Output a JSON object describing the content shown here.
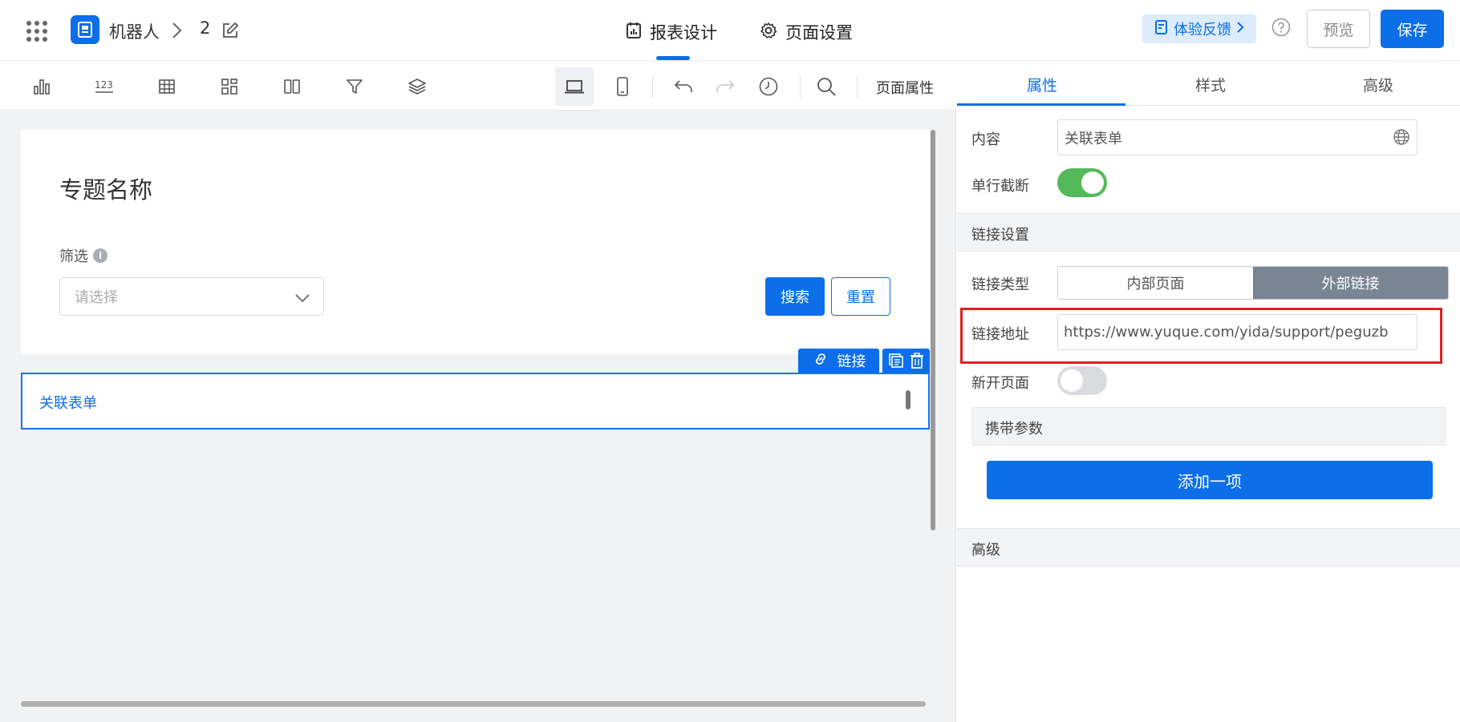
{
  "header": {
    "app_name": "机器人",
    "page_number": "2",
    "tabs": [
      {
        "label": "报表设计",
        "icon": "report-icon",
        "active": true
      },
      {
        "label": "页面设置",
        "icon": "gear-icon",
        "active": false
      }
    ],
    "feedback_label": "体验反馈",
    "preview_label": "预览",
    "save_label": "保存"
  },
  "toolbar": {
    "icons": [
      "bar-chart-icon",
      "number-icon",
      "table-icon",
      "layout-icon",
      "columns-icon",
      "filter-icon",
      "layers-icon",
      "desktop-icon",
      "mobile-icon",
      "undo-icon",
      "redo-icon",
      "history-icon",
      "search-icon"
    ],
    "page_props_label": "页面属性"
  },
  "canvas": {
    "page_title": "专题名称",
    "filter_label": "筛选",
    "filter_placeholder": "请选择",
    "search_label": "搜索",
    "reset_label": "重置",
    "selected_component_badge": "链接",
    "link_component_text": "关联表单"
  },
  "panel": {
    "tabs": [
      "属性",
      "样式",
      "高级"
    ],
    "active_tab": 0,
    "content_label": "内容",
    "content_value": "关联表单",
    "single_line_label": "单行截断",
    "single_line_on": true,
    "link_section_label": "链接设置",
    "link_type_label": "链接类型",
    "link_type_options": [
      "内部页面",
      "外部链接"
    ],
    "link_type_selected": "外部链接",
    "link_url_label": "链接地址",
    "link_url_value": "https://www.yuque.com/yida/support/peguzb",
    "new_page_label": "新开页面",
    "new_page_on": false,
    "params_label": "携带参数",
    "add_item_label": "添加一项",
    "advanced_label": "高级"
  },
  "colors": {
    "primary": "#0c6ee8",
    "toggle_on": "#55b95a",
    "segment_selected": "#7a8593",
    "highlight": "#e02020"
  }
}
